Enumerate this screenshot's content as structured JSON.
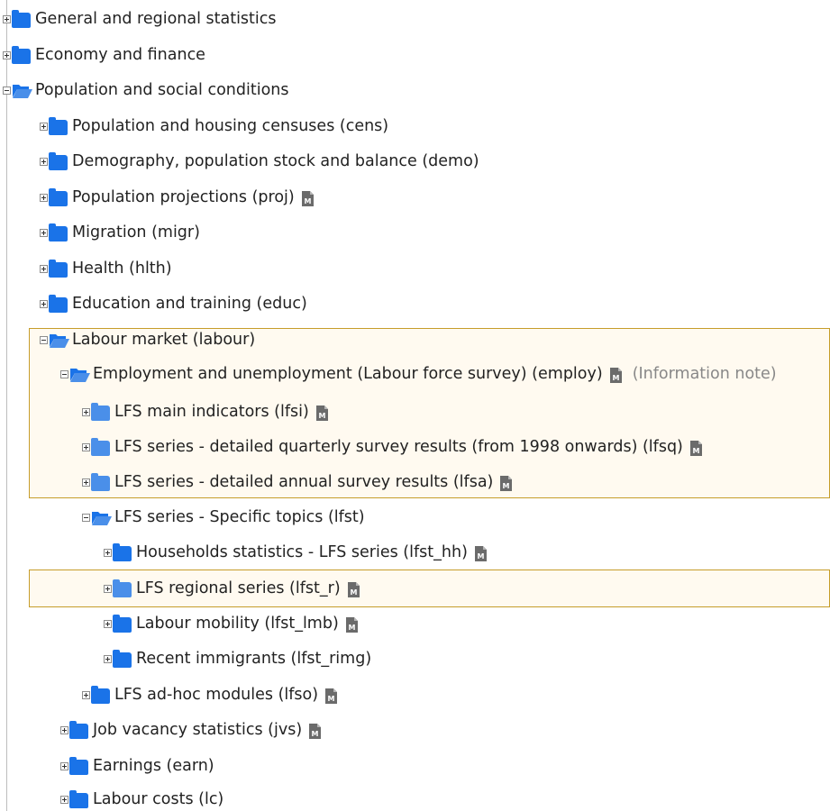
{
  "tree": {
    "rows": [
      {
        "label": "General and regional statistics",
        "meta": false
      },
      {
        "label": "Economy and finance",
        "meta": false
      },
      {
        "label": "Population and social conditions",
        "meta": false
      },
      {
        "label": "Population and housing censuses (cens)",
        "meta": false
      },
      {
        "label": "Demography, population stock and balance (demo)",
        "meta": false
      },
      {
        "label": "Population projections (proj)",
        "meta": true
      },
      {
        "label": "Migration (migr)",
        "meta": false
      },
      {
        "label": "Health (hlth)",
        "meta": false
      },
      {
        "label": "Education and training (educ)",
        "meta": false
      },
      {
        "label": "Labour market (labour)",
        "meta": false
      },
      {
        "label": "Employment and unemployment (Labour force survey) (employ)",
        "meta": true,
        "note": "(Information note)"
      },
      {
        "label": "LFS main indicators (lfsi)",
        "meta": true
      },
      {
        "label": "LFS series - detailed quarterly survey results (from 1998 onwards) (lfsq)",
        "meta": true
      },
      {
        "label": "LFS series - detailed annual survey results (lfsa)",
        "meta": true
      },
      {
        "label": "LFS series - Specific topics (lfst)",
        "meta": false
      },
      {
        "label": "Households statistics - LFS series (lfst_hh)",
        "meta": true
      },
      {
        "label": "LFS regional series (lfst_r)",
        "meta": true
      },
      {
        "label": "Labour mobility (lfst_lmb)",
        "meta": true
      },
      {
        "label": "Recent immigrants (lfst_rimg)",
        "meta": false
      },
      {
        "label": "LFS ad-hoc modules (lfso)",
        "meta": true
      },
      {
        "label": "Job vacancy statistics (jvs)",
        "meta": true
      },
      {
        "label": "Earnings (earn)",
        "meta": false
      },
      {
        "label": "Labour costs (lc)",
        "meta": false
      }
    ]
  },
  "icons": {
    "metadata": "metadata-icon",
    "folder_closed": "folder-closed-icon",
    "folder_open": "folder-open-icon",
    "expand": "plus-toggle-icon",
    "collapse": "minus-toggle-icon"
  },
  "colors": {
    "folder": "#1a73e8",
    "highlight_border": "#c69d2a",
    "highlight_bg": "#fffaf0",
    "note_text": "#888888"
  }
}
